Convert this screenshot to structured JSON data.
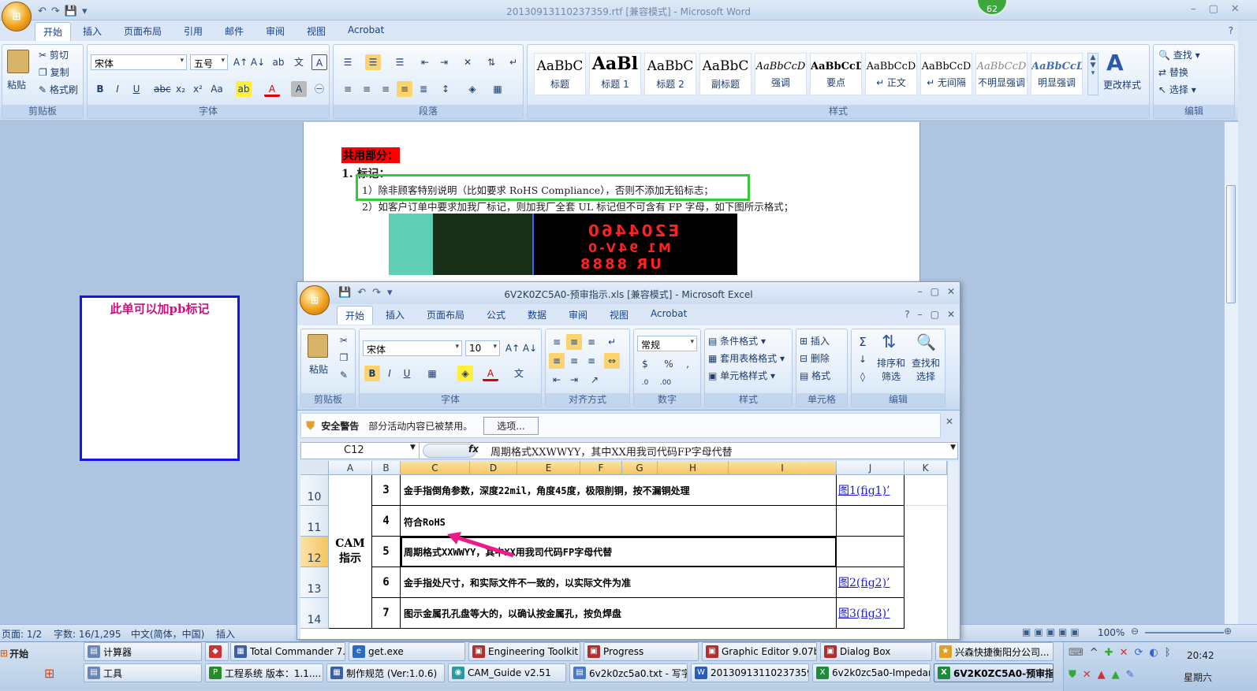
{
  "word": {
    "title": "20130913110237359.rtf [兼容模式] - Microsoft Word",
    "badge": "62",
    "tabs": [
      "开始",
      "插入",
      "页面布局",
      "引用",
      "邮件",
      "审阅",
      "视图",
      "Acrobat"
    ],
    "clipboard": {
      "paste": "粘贴",
      "cut": "剪切",
      "copy": "复制",
      "format_painter": "格式刷",
      "group": "剪贴板"
    },
    "font": {
      "name": "宋体",
      "size": "五号",
      "group": "字体"
    },
    "paragraph_group": "段落",
    "styles": [
      {
        "sample": "AaBbC",
        "name": "标题"
      },
      {
        "sample": "AaBl",
        "name": "标题 1"
      },
      {
        "sample": "AaBbC",
        "name": "标题 2"
      },
      {
        "sample": "AaBbC",
        "name": "副标题"
      },
      {
        "sample": "AaBbCcD",
        "name": "强调"
      },
      {
        "sample": "AaBbCcD",
        "name": "要点"
      },
      {
        "sample": "AaBbCcD",
        "name": "↵ 正文"
      },
      {
        "sample": "AaBbCcD",
        "name": "↵ 无间隔"
      },
      {
        "sample": "AaBbCcD",
        "name": "不明显强调"
      },
      {
        "sample": "AaBbCcD",
        "name": "明显强调"
      }
    ],
    "styles_group": "样式",
    "change_styles": "更改样式",
    "editing": {
      "find": "查找",
      "replace": "替换",
      "select": "选择",
      "group": "编辑"
    },
    "doc": {
      "section_title": "共用部分：",
      "item1": "1.  标记：",
      "line1": "1）除非顾客特别说明（比如要求 RoHS Compliance），否则不添加无铅标志；",
      "line2": "2）如客户订单中要求加我厂标记，则加我厂全套 UL 标记但不可含有 FP 字母，如下图所示格式；",
      "img_text1": "E204460",
      "img_text2": "M1 94V-0",
      "img_text3": "UR 8888"
    },
    "status": {
      "page": "页面: 1/2",
      "words": "字数: 16/1,295",
      "lang": "中文(简体，中国)",
      "mode": "插入",
      "zoom": "100%"
    }
  },
  "note": {
    "text": "此单可以加pb标记"
  },
  "excel": {
    "title": "6V2K0ZC5A0-预审指示.xls  [兼容模式] - Microsoft Excel",
    "tabs": [
      "开始",
      "插入",
      "页面布局",
      "公式",
      "数据",
      "审阅",
      "视图",
      "Acrobat"
    ],
    "font": {
      "name": "宋体",
      "size": "10",
      "group": "字体"
    },
    "paste": "粘贴",
    "clipboard_group": "剪贴板",
    "align_group": "对齐方式",
    "number": {
      "format": "常规",
      "group": "数字"
    },
    "styles": {
      "cond": "条件格式",
      "table": "套用表格格式",
      "cell": "单元格样式",
      "group": "样式"
    },
    "cells": {
      "insert": "插入",
      "delete": "删除",
      "format": "格式",
      "group": "单元格"
    },
    "edit": {
      "sort": "排序和\n筛选",
      "find": "查找和\n选择",
      "group": "编辑"
    },
    "warning": {
      "title": "安全警告",
      "text": "部分活动内容已被禁用。",
      "button": "选项..."
    },
    "name_box": "C12",
    "formula": "周期格式XXWWYY，其中XX用我司代码FP字母代替",
    "columns": [
      "A",
      "B",
      "C",
      "D",
      "E",
      "F",
      "G",
      "H",
      "I",
      "J",
      "K"
    ],
    "rows": [
      {
        "num": "10",
        "idx": "3",
        "text": "金手指倒角参数，深度22mil，角度45度，极限削铜，按不漏铜处理",
        "link": "图1(fig1)’"
      },
      {
        "num": "11",
        "idx": "4",
        "text": "符合RoHS",
        "link": ""
      },
      {
        "num": "12",
        "idx": "5",
        "text": "周期格式XXWWYY，其中XX用我司代码FP字母代替",
        "link": ""
      },
      {
        "num": "13",
        "idx": "6",
        "text": "金手指处尺寸，和实际文件不一致的，以实际文件为准",
        "link": "图2(fig2)’"
      },
      {
        "num": "14",
        "idx": "7",
        "text": "图示金属孔孔盘等大的，以确认按金属孔，按负焊盘",
        "link": "图3(fig3)’"
      }
    ],
    "merged_a": "CAM\n指示"
  },
  "taskbar": {
    "start": "开始",
    "row1": [
      "计算器",
      "",
      "Total Commander 7.0 ...",
      "get.exe",
      "Engineering Toolkit 9.0...",
      "Progress",
      "Graphic Editor 9.07b2 (...",
      "Dialog Box",
      "兴森快捷衡阳分公司..."
    ],
    "row2": [
      "工具",
      "工程系统  版本：1.1....",
      "制作规范 (Ver:1.0.6)",
      "CAM_Guide v2.51",
      "6v2k0zc5a0.txt - 写字板",
      "20130913110237359.rt...",
      "6v2k0zc5a0-Impedance...",
      "6V2K0ZC5A0-预审指..."
    ],
    "time": "20:42",
    "day": "星期六"
  }
}
